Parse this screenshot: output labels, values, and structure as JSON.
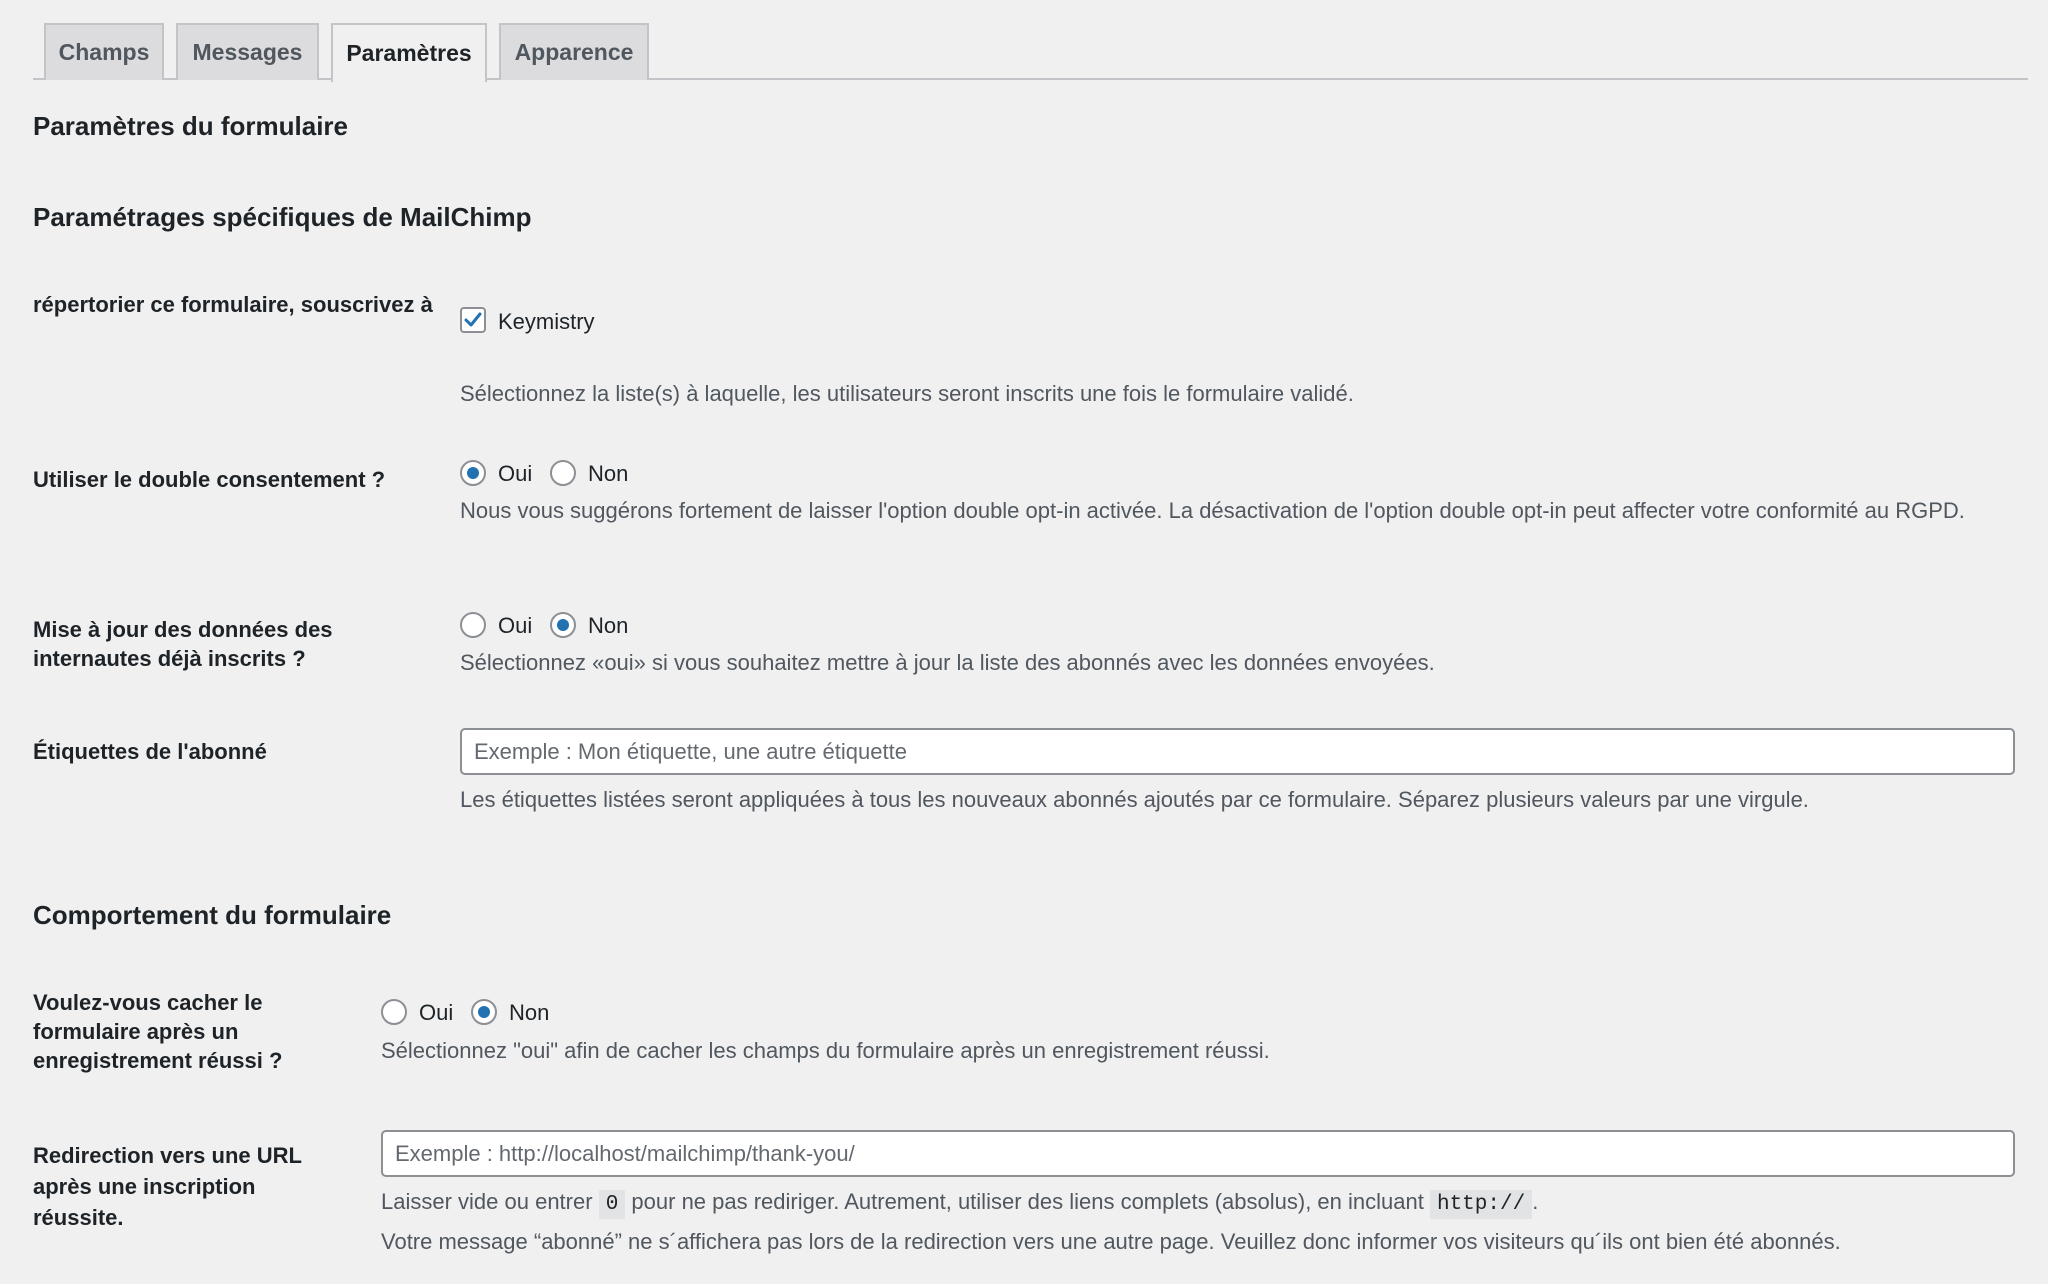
{
  "tabs": [
    {
      "label": "Champs",
      "active": false
    },
    {
      "label": "Messages",
      "active": false
    },
    {
      "label": "Paramètres",
      "active": true
    },
    {
      "label": "Apparence",
      "active": false
    }
  ],
  "titles": {
    "form_settings": "Paramètres du formulaire",
    "mailchimp_settings": "Paramétrages spécifiques de MailChimp",
    "form_behavior": "Comportement du formulaire"
  },
  "list_field": {
    "label": "répertorier ce formulaire, souscrivez à",
    "option": "Keymistry",
    "checked": true,
    "description": "Sélectionnez la liste(s) à laquelle, les utilisateurs seront inscrits une fois le formulaire validé."
  },
  "double_optin": {
    "label": "Utiliser le double consentement ?",
    "yes": "Oui",
    "no": "Non",
    "selected": "Oui",
    "description": "Nous vous suggérons fortement de laisser l'option double opt-in activée. La désactivation de l'option double opt-in peut affecter votre conformité au RGPD."
  },
  "update_existing": {
    "label": "Mise à jour des données des internautes déjà inscrits ?",
    "yes": "Oui",
    "no": "Non",
    "selected": "Non",
    "description": "Sélectionnez «oui» si vous souhaitez mettre à jour la liste des abonnés avec les données envoyées."
  },
  "tags": {
    "label": "Étiquettes de l'abonné",
    "value": "",
    "placeholder": "Exemple : Mon étiquette, une autre étiquette",
    "description": "Les étiquettes listées seront appliquées à tous les nouveaux abonnés ajoutés par ce formulaire. Séparez plusieurs valeurs par une virgule."
  },
  "hide_form": {
    "label": "Voulez-vous cacher le formulaire après un enregistrement réussi ?",
    "yes": "Oui",
    "no": "Non",
    "selected": "Non",
    "description": "Sélectionnez \"oui\" afin de cacher les champs du formulaire après un enregistrement réussi."
  },
  "redirect": {
    "label": "Redirection vers une URL après une inscription réussite.",
    "value": "",
    "placeholder": "Exemple : http://localhost/mailchimp/thank-you/",
    "desc_part1": "Laisser vide ou entrer",
    "code_zero": "0",
    "desc_part2": "pour ne pas rediriger. Autrement, utiliser des liens complets (absolus), en incluant",
    "code_http": "http://",
    "desc_part3": ".",
    "note": "Votre message “abonné” ne s´affichera pas lors de la redirection vers une autre page. Veuillez donc informer vos visiteurs qu´ils ont bien été abonnés."
  },
  "colors": {
    "accent": "#2271b1",
    "background": "#f0f0f1",
    "text": "#1d2327",
    "muted": "#50575e"
  }
}
